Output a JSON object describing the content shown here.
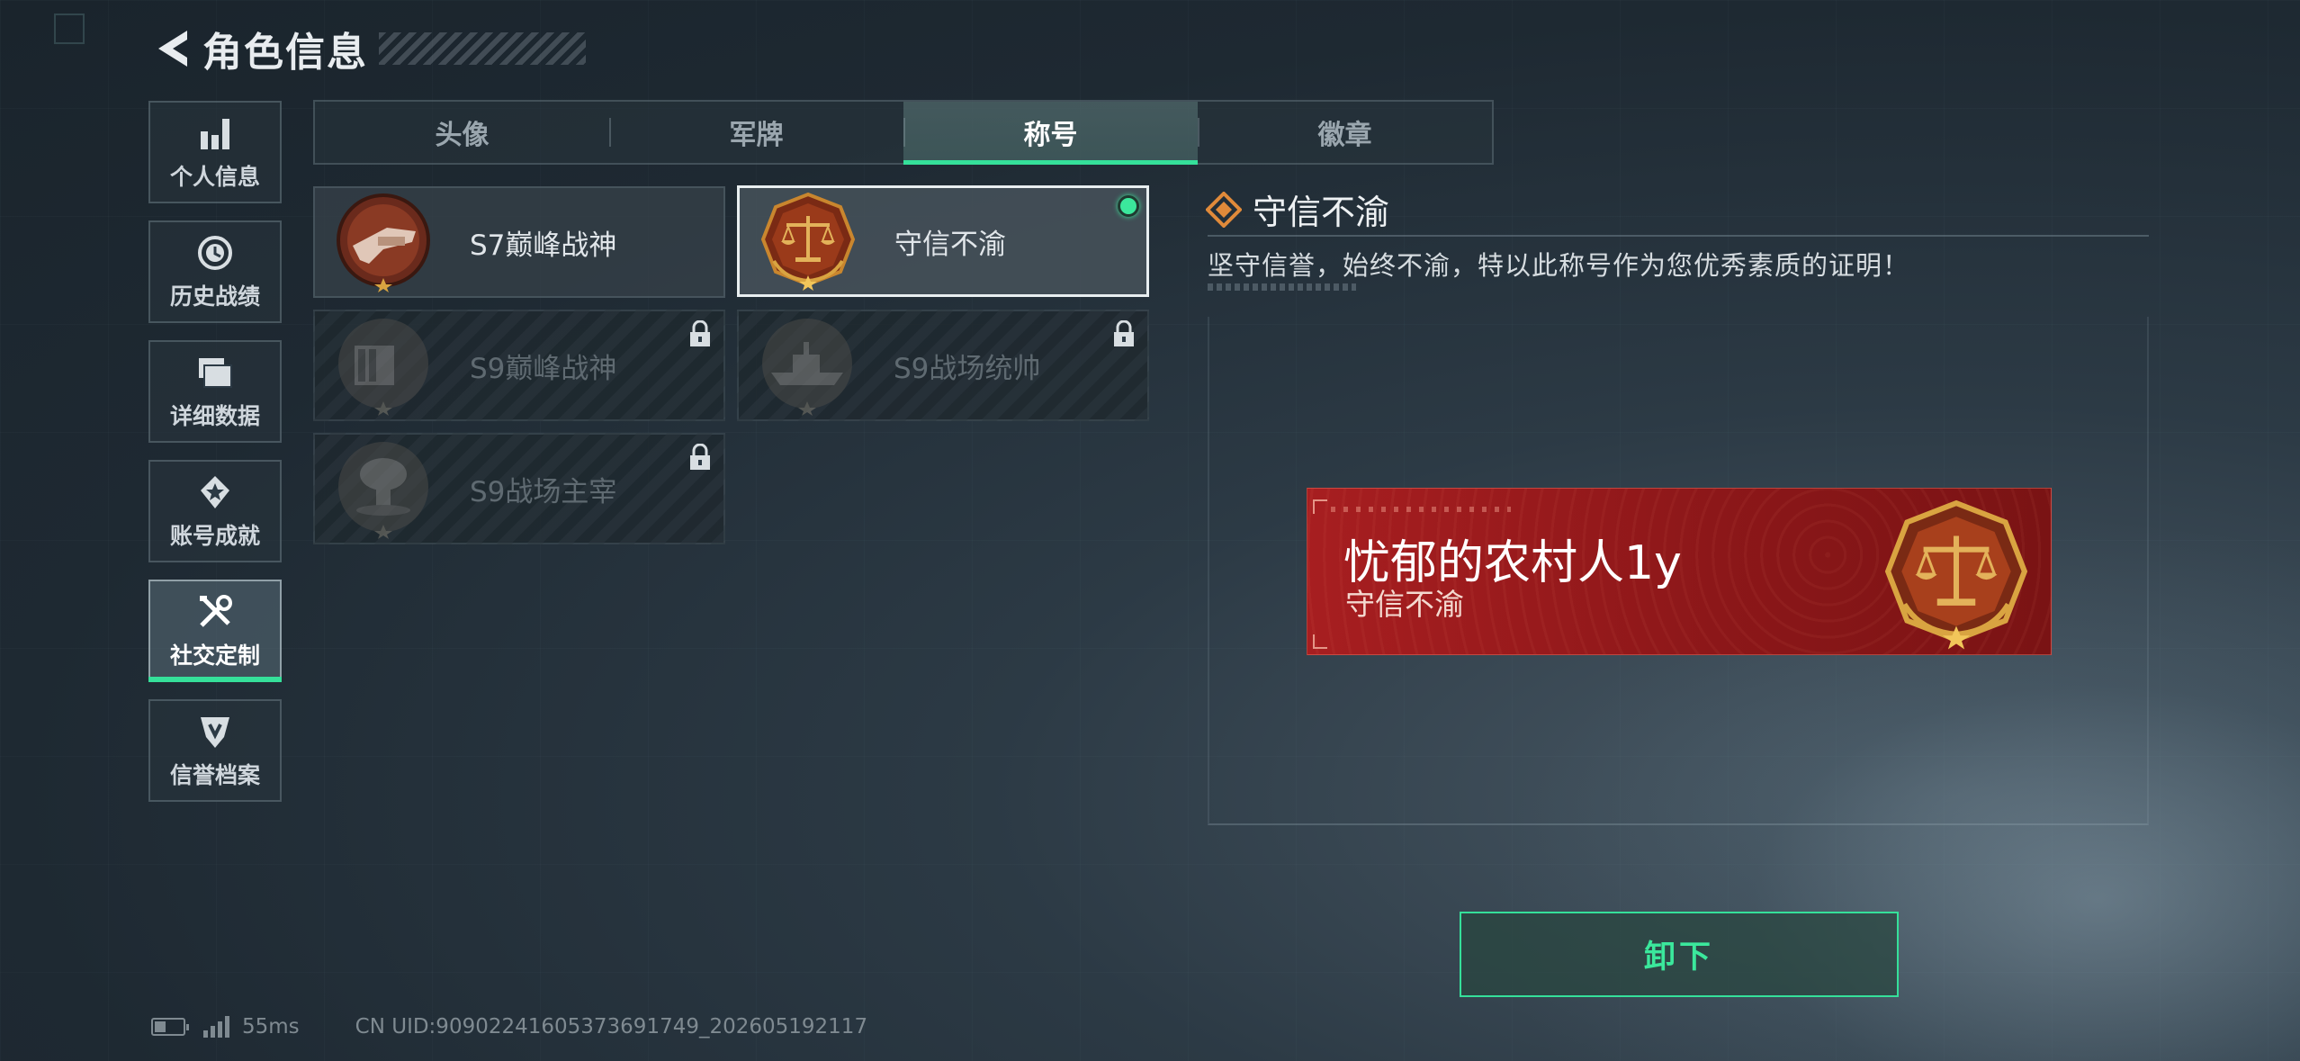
{
  "header": {
    "title": "角色信息"
  },
  "sidebar": {
    "items": [
      {
        "label": "个人信息",
        "icon": "bar-chart-icon"
      },
      {
        "label": "历史战绩",
        "icon": "clock-history-icon"
      },
      {
        "label": "详细数据",
        "icon": "folders-icon"
      },
      {
        "label": "账号成就",
        "icon": "achievement-icon"
      },
      {
        "label": "社交定制",
        "icon": "tools-icon",
        "active": true
      },
      {
        "label": "信誉档案",
        "icon": "credit-shield-icon"
      }
    ]
  },
  "tabs": [
    {
      "label": "头像"
    },
    {
      "label": "军牌"
    },
    {
      "label": "称号",
      "active": true
    },
    {
      "label": "徽章"
    }
  ],
  "titles": [
    {
      "name": "S7巅峰战神",
      "locked": false,
      "selected": false
    },
    {
      "name": "守信不渝",
      "locked": false,
      "selected": true,
      "equipped": true
    },
    {
      "name": "S9巅峰战神",
      "locked": true
    },
    {
      "name": "S9战场统帅",
      "locked": true
    },
    {
      "name": "S9战场主宰",
      "locked": true
    }
  ],
  "detail": {
    "title": "守信不渝",
    "description": "坚守信誉，始终不渝，特以此称号作为您优秀素质的证明！"
  },
  "banner": {
    "player_name": "忧郁的农村人1y",
    "title": "守信不渝"
  },
  "actions": {
    "unequip_label": "卸下"
  },
  "footer": {
    "ping": "55ms",
    "uid": "CN UID:9090224160537369174​9_202605192117"
  },
  "colors": {
    "accent": "#35e09a",
    "banner_red": "#a71e20",
    "gold": "#d9a441"
  }
}
